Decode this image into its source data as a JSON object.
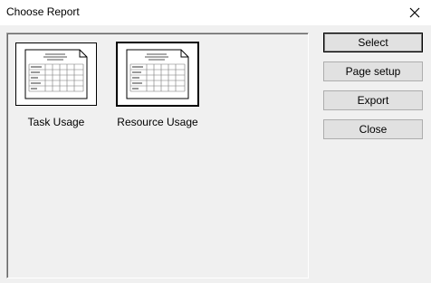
{
  "window": {
    "title": "Choose Report",
    "close_glyph": "✕"
  },
  "reports": [
    {
      "label": "Task Usage",
      "icon": "report-thumbnail-icon"
    },
    {
      "label": "Resource Usage",
      "icon": "report-thumbnail-icon"
    }
  ],
  "buttons": {
    "select": "Select",
    "page_setup": "Page setup",
    "export": "Export",
    "close": "Close"
  },
  "colors": {
    "background": "#f0f0f0",
    "button_face": "#e1e1e1",
    "button_border": "#adadad"
  }
}
